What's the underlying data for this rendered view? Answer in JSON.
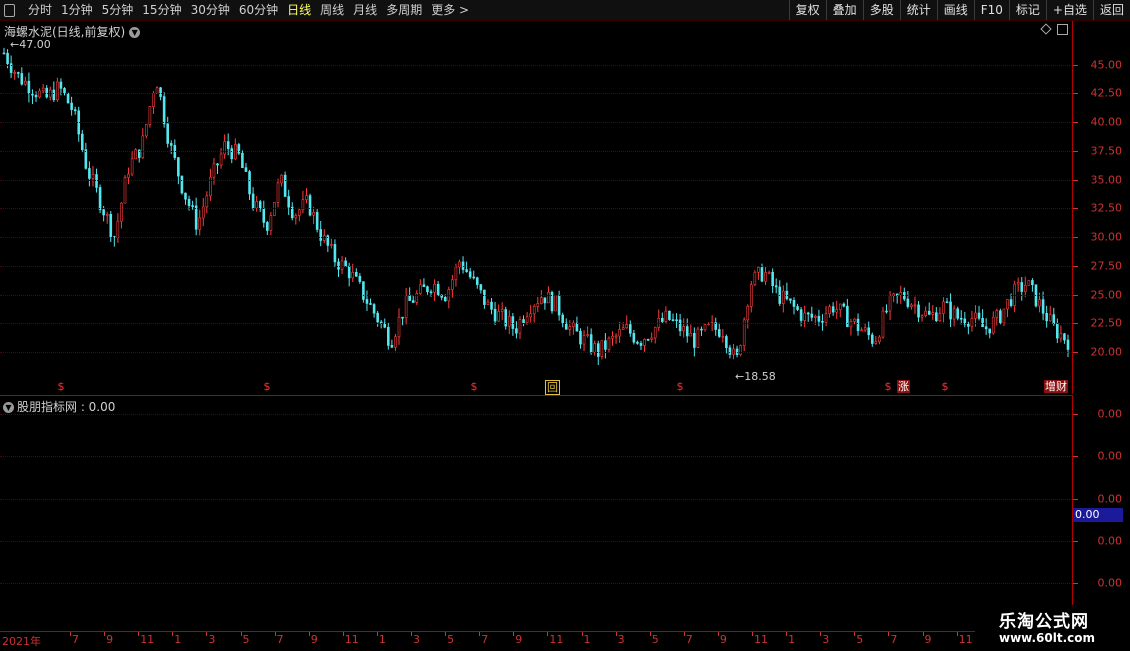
{
  "toolbar": {
    "periods": [
      "分时",
      "1分钟",
      "5分钟",
      "15分钟",
      "30分钟",
      "60分钟",
      "日线",
      "周线",
      "月线",
      "多周期",
      "更多 >"
    ],
    "active_period": "日线",
    "buttons": [
      "复权",
      "叠加",
      "多股",
      "统计",
      "画线",
      "F10",
      "标记",
      "+自选",
      "返回"
    ]
  },
  "main": {
    "title": "海螺水泥(日线,前复权)",
    "high_label": "47.00",
    "low_label": "18.58",
    "markers": [
      "$",
      "$",
      "$",
      "$",
      "$",
      "$"
    ],
    "tag_box": "回",
    "tag_zhang": "涨",
    "tag_zengcai": "增财",
    "y_labels": [
      "45.00",
      "42.50",
      "40.00",
      "37.50",
      "35.00",
      "32.50",
      "30.00",
      "27.50",
      "25.00",
      "22.50",
      "20.00"
    ]
  },
  "indicator": {
    "title": "股朋指标网 : 0.00",
    "y_labels": [
      "0.00",
      "0.00",
      "0.00",
      "0.00",
      "0.00"
    ],
    "current_value": "0.00"
  },
  "xaxis": {
    "labels": [
      "2021年",
      "7",
      "9",
      "11",
      "1",
      "3",
      "5",
      "7",
      "9",
      "11",
      "1",
      "3",
      "5",
      "7",
      "9",
      "11",
      "1",
      "3",
      "5",
      "7",
      "9",
      "11",
      "1",
      "3",
      "5",
      "7",
      "9",
      "11"
    ]
  },
  "watermark": {
    "main": "乐淘公式网",
    "sub": "www.60lt.com"
  },
  "chart_data": {
    "type": "candlestick",
    "ylim": [
      18,
      48
    ],
    "close": [
      46,
      44,
      43,
      42,
      43,
      41,
      36,
      33,
      30,
      36,
      38,
      44,
      38,
      34,
      31,
      35,
      38,
      37,
      33,
      31,
      35,
      32,
      33,
      30,
      28,
      27,
      25,
      23,
      21,
      24,
      25,
      26,
      25,
      28,
      26,
      24,
      23,
      22,
      24,
      25,
      24,
      22,
      21,
      20,
      21,
      22,
      21,
      22,
      23,
      22,
      21,
      22,
      22,
      19,
      26,
      27,
      25,
      24,
      23,
      23,
      24,
      23,
      22,
      21,
      24,
      25,
      24,
      23,
      24,
      23,
      23,
      22,
      23,
      25,
      26,
      24,
      22,
      21
    ],
    "colors": {
      "up": "#ff3c3c",
      "down": "#54e8f0"
    }
  }
}
